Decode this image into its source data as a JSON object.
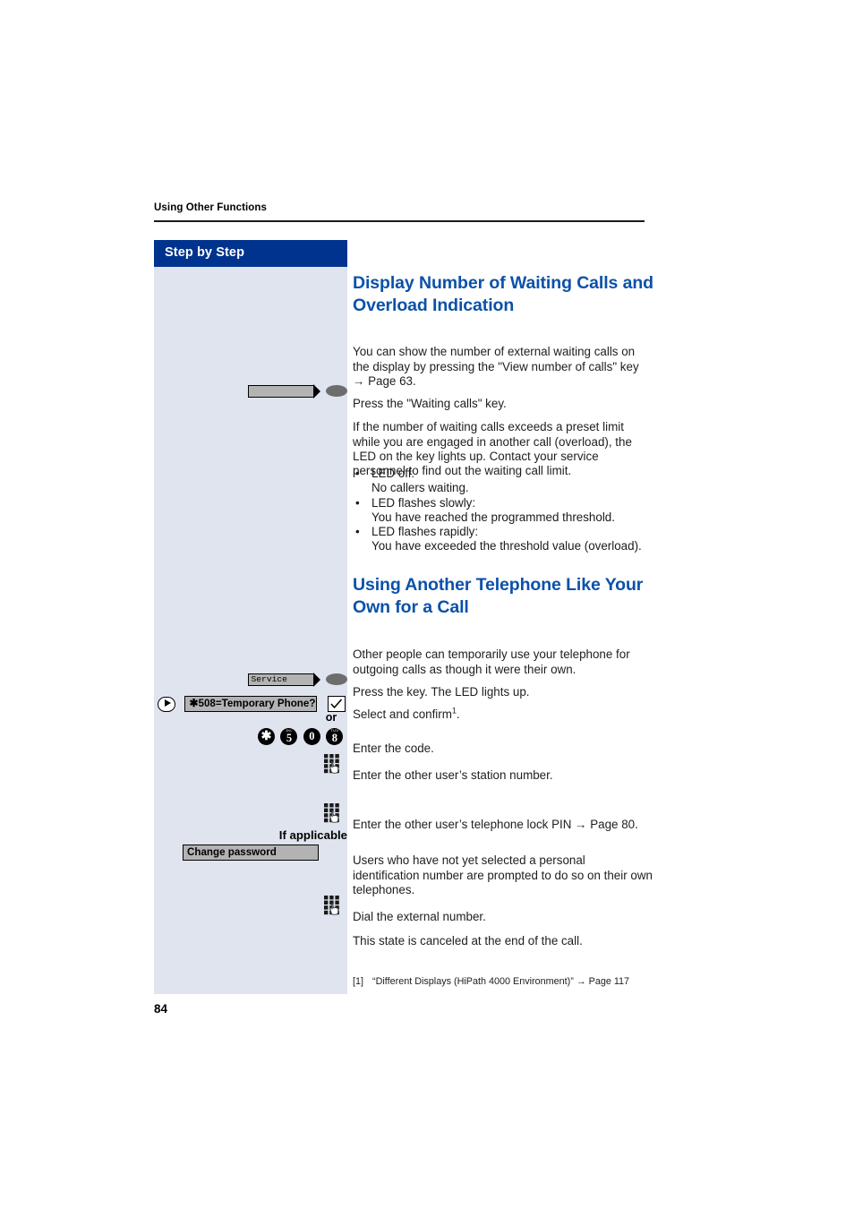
{
  "document": {
    "running_header": "Using Other Functions",
    "page_number": "84"
  },
  "sidebar": {
    "title": "Step by Step"
  },
  "sections": [
    {
      "heading": "Display Number of Waiting Calls and Overload Indication",
      "intro": "You can show the number of external waiting calls on the display by pressing the \"View number of calls\" key → Page 63.",
      "step_press": "Press the \"Waiting calls\" key.",
      "overload_para": "If the number of waiting calls exceeds a preset limit while you are engaged in another call (overload), the LED on the key lights up. Contact your service personnel to find out the waiting call limit.",
      "bullets": [
        {
          "title": "LED off:",
          "detail": "No callers waiting."
        },
        {
          "title": "LED flashes slowly:",
          "detail": "You have reached the programmed threshold."
        },
        {
          "title": "LED flashes rapidly:",
          "detail": "You have exceeded the threshold value (overload)."
        }
      ]
    },
    {
      "heading": "Using Another Telephone Like Your Own for a Call",
      "intro": "Other people can temporarily use your telephone for outgoing calls as though it were their own.",
      "steps": [
        "Press the key. The LED lights up.",
        "Select and confirm",
        "Enter the code.",
        "Enter the other user’s station number.",
        "Enter the other user’s telephone lock PIN → Page 80.",
        "Users who have not yet selected a personal identification number are prompted to do so on their own telephones.",
        "Dial the external number.",
        "This state is canceled at the end of the call."
      ],
      "footnote_marker": "1",
      "step_period": "."
    }
  ],
  "keys": {
    "waiting_calls_key_label": "",
    "service_key_label": "Service",
    "temporary_phone_option": "508=Temporary Phone?",
    "temporary_phone_star": "✱",
    "or_label": "or",
    "dial_code_digits": [
      "✱",
      "5",
      "0",
      "8"
    ],
    "dial_code_mini": [
      "",
      "JKL",
      "",
      "TUV"
    ],
    "if_applicable_label": "If applicable",
    "change_password_option": "Change password"
  },
  "footnote": {
    "number": "[1]",
    "text": "“Different Displays (HiPath 4000 Environment)” → Page 117"
  },
  "colors": {
    "heading_blue": "#0b51a8",
    "sidebar_header_blue": "#00338e",
    "sidebar_body": "#dfe4ef",
    "key_gray": "#b3b3b3",
    "led_gray": "#6d6d6d"
  }
}
